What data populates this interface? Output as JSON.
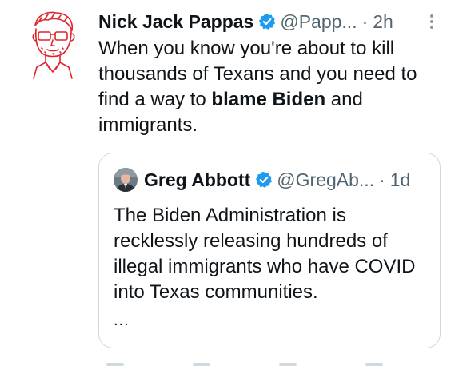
{
  "tweet": {
    "author_name": "Nick Jack Pappas",
    "handle": "@Papp...",
    "separator": "·",
    "time": "2h",
    "avatar_icon": "line-art-portrait",
    "text_before": "When you know you're about to kill thousands of Texans and you need to find a way to ",
    "text_bold": "blame Biden",
    "text_after": " and immigrants."
  },
  "quoted": {
    "author_name": "Greg Abbott",
    "handle": "@GregAb...",
    "separator": "·",
    "time": "1d",
    "text": "The Biden Administration is recklessly releasing hundreds of illegal immigrants who have COVID into Texas communities.",
    "ellipsis": "..."
  },
  "colors": {
    "verified": "#1d9bf0",
    "secondary_text": "#536471",
    "border": "#cfd9de",
    "avatar_line": "#e0242b"
  }
}
